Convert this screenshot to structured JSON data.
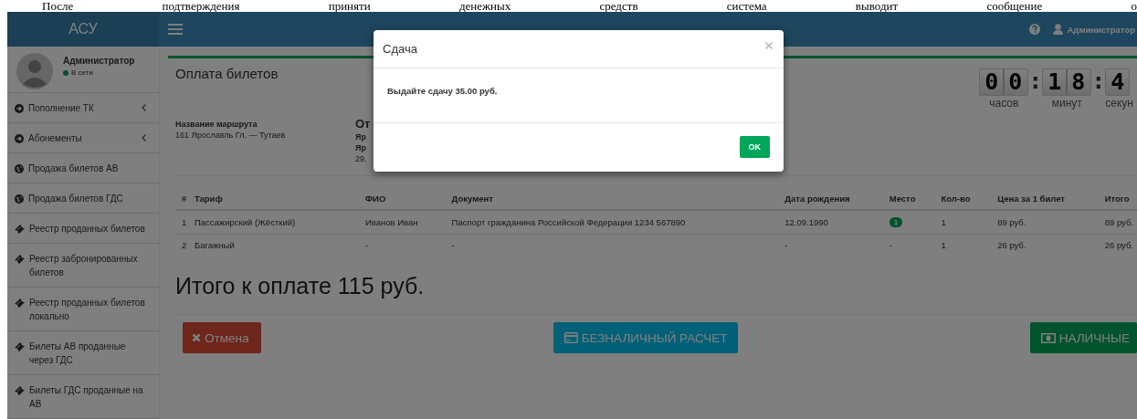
{
  "document_text": "После подтверждения приняти денежных средств система выводит сообщение о",
  "app": {
    "logo": "АСУ",
    "header": {
      "user": "Администратор"
    },
    "sidebar": {
      "user": {
        "name": "Администратор",
        "status": "В сети",
        "online": true
      },
      "items": [
        {
          "label": "Пополнение ТК",
          "kind": "submenu"
        },
        {
          "label": "Абонементы",
          "kind": "submenu"
        },
        {
          "label": "Продажа билетов АВ",
          "kind": "sale"
        },
        {
          "label": "Продажа билетов ГДС",
          "kind": "sale"
        },
        {
          "label": "Реестр проданных билетов",
          "kind": "registry"
        },
        {
          "label": "Реестр забронированных билетов",
          "kind": "registry"
        },
        {
          "label": "Реестр проданных билетов локально",
          "kind": "registry"
        },
        {
          "label": "Билеты АВ проданные через ГДС",
          "kind": "registry"
        },
        {
          "label": "Билеты ГДС проданные на АВ",
          "kind": "registry"
        }
      ]
    },
    "panel": {
      "title": "Оплата билетов",
      "timer": [
        {
          "kind": "digits",
          "text": "00",
          "label": "часов"
        },
        {
          "kind": "separator",
          "text": ":"
        },
        {
          "kind": "digits",
          "text": "18",
          "label": "минут"
        },
        {
          "kind": "separator",
          "text": ":"
        },
        {
          "kind": "digits",
          "text": "4",
          "label": "секун"
        }
      ],
      "route": {
        "label": "Название маршрута",
        "value": "161 Ярославль Гл. — Тутаев"
      },
      "departure": [
        "От",
        "Яр",
        "Яр",
        "29."
      ],
      "table": {
        "columns": [
          "#",
          "Тариф",
          "ФИО",
          "Документ",
          "Дата рождения",
          "Место",
          "Кол-во",
          "Цена за 1 билет",
          "Итого"
        ],
        "rows": [
          {
            "cells": [
              "1",
              "Пассажирский (Жёсткий)",
              "Иванов Иван",
              "Паспорт гражданина Российской Федерации 1234 567890",
              "12.09.1990",
              "1",
              "1",
              "89 руб.",
              "89 руб."
            ],
            "seat_badge": true
          },
          {
            "cells": [
              "2",
              "Багажный",
              "-",
              "-",
              "-",
              "-",
              "1",
              "26 руб.",
              "26 руб."
            ],
            "seat_badge": false
          }
        ]
      },
      "total": "Итого к оплате 115 руб.",
      "buttons": [
        {
          "label": "Отмена",
          "kind": "cancel"
        },
        {
          "label": "БЕЗНАЛИЧНЫЙ РАСЧЕТ",
          "kind": "card"
        },
        {
          "label": "НАЛИЧНЫЕ",
          "kind": "cash"
        }
      ]
    },
    "modal": {
      "title": "Сдача",
      "message": "Выдайте сдачу 35.00 руб.",
      "button": "OK"
    }
  }
}
